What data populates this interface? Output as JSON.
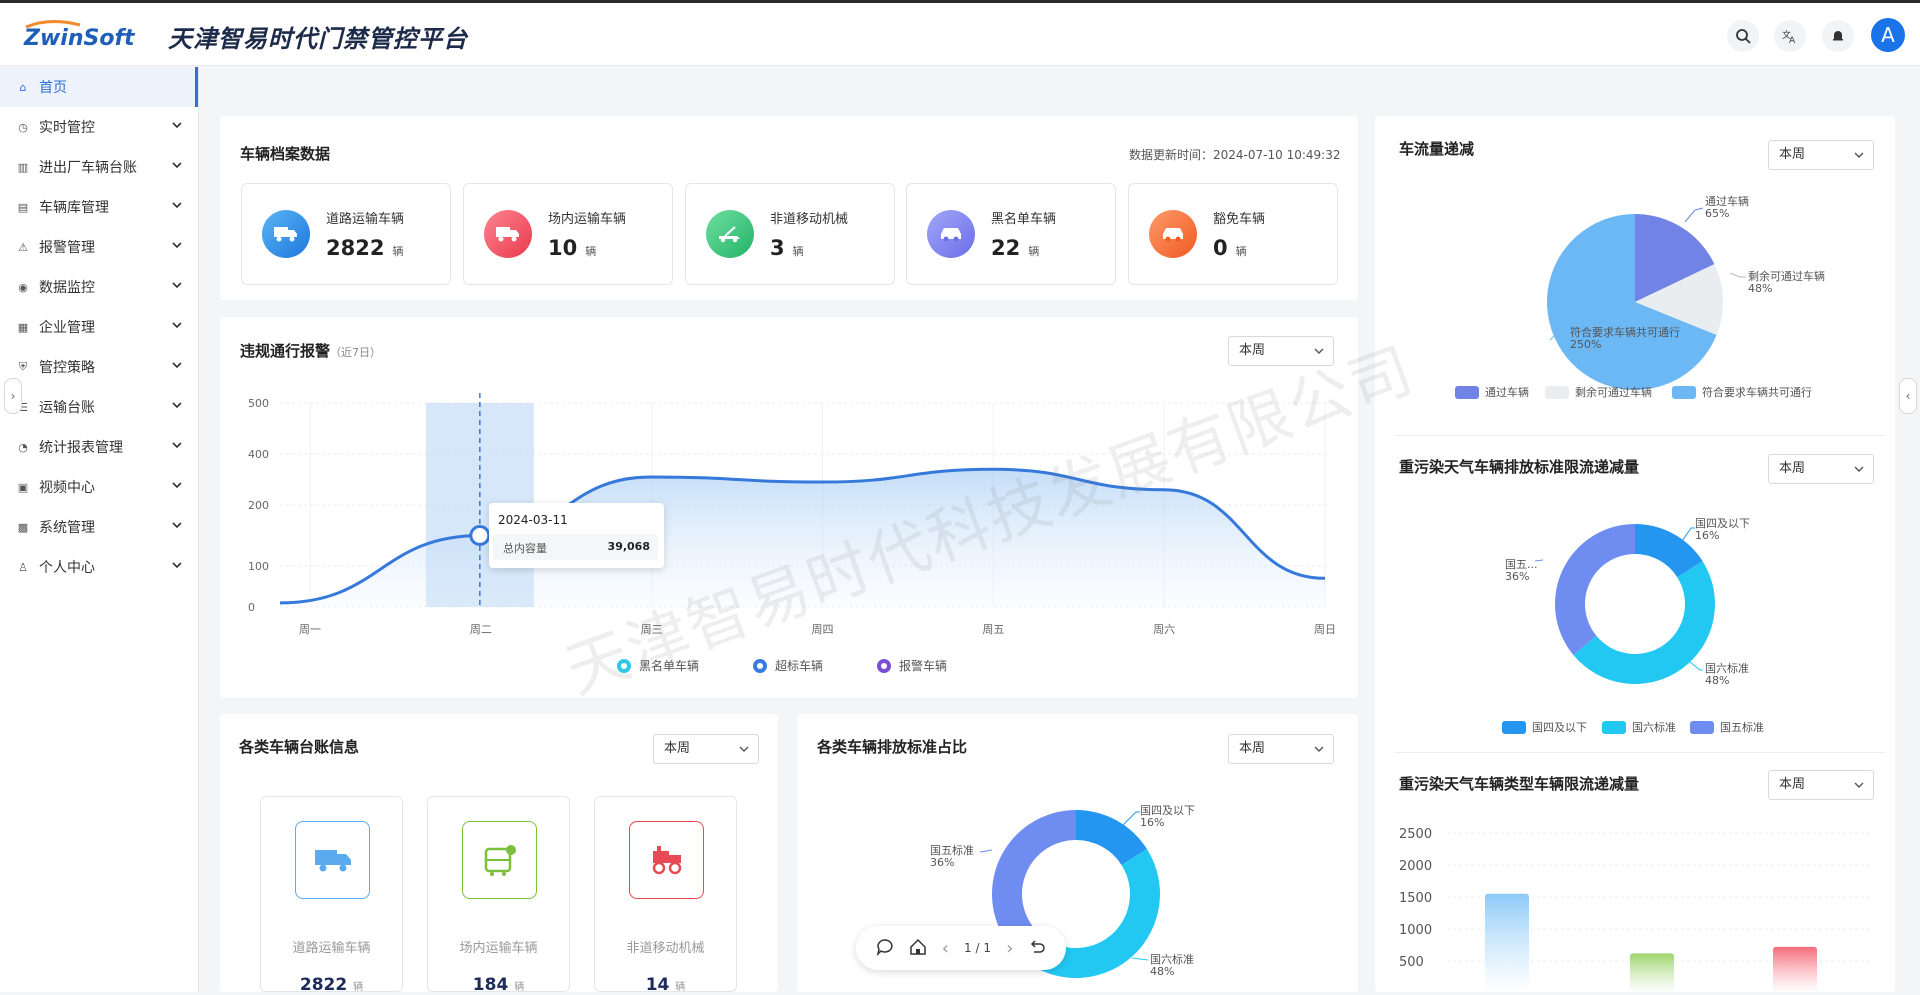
{
  "header": {
    "logo_text": "ZwinSoft",
    "app_title": "天津智易时代门禁管控平台",
    "avatar_letter": "A"
  },
  "sidebar": {
    "items": [
      {
        "label": "首页",
        "icon": "home-icon"
      },
      {
        "label": "实时管控",
        "icon": "clock-icon"
      },
      {
        "label": "进出厂车辆台账",
        "icon": "chart-icon"
      },
      {
        "label": "车辆库管理",
        "icon": "doc-icon"
      },
      {
        "label": "报警管理",
        "icon": "alarm-icon"
      },
      {
        "label": "数据监控",
        "icon": "location-icon"
      },
      {
        "label": "企业管理",
        "icon": "building-icon"
      },
      {
        "label": "管控策略",
        "icon": "shield-icon"
      },
      {
        "label": "运输台账",
        "icon": "ledger-icon"
      },
      {
        "label": "统计报表管理",
        "icon": "gauge-icon"
      },
      {
        "label": "视频中心",
        "icon": "video-icon"
      },
      {
        "label": "系统管理",
        "icon": "grid-icon"
      },
      {
        "label": "个人中心",
        "icon": "user-icon"
      }
    ]
  },
  "archive": {
    "title": "车辆档案数据",
    "update_label": "数据更新时间：",
    "update_time": "2024-07-10 10:49:32",
    "stats": [
      {
        "label": "道路运输车辆",
        "value": "2822",
        "unit": "辆",
        "color": "#2f8fe8"
      },
      {
        "label": "场内运输车辆",
        "value": "10",
        "unit": "辆",
        "color": "#ef4f5f"
      },
      {
        "label": "非道移动机械",
        "value": "3",
        "unit": "辆",
        "color": "#3cc47c"
      },
      {
        "label": "黑名单车辆",
        "value": "22",
        "unit": "辆",
        "color": "#7b7ff0"
      },
      {
        "label": "豁免车辆",
        "value": "0",
        "unit": "辆",
        "color": "#f2703d"
      }
    ]
  },
  "violation": {
    "title": "违规通行报警",
    "subtitle": "（近7日）",
    "select": "本周",
    "tooltip": {
      "date": "2024-03-11",
      "label": "总内容量",
      "value": "39,068"
    },
    "legend": [
      {
        "name": "黑名单车辆",
        "color": "#2fc8e8"
      },
      {
        "name": "超标车辆",
        "color": "#3a7be0"
      },
      {
        "name": "报警车辆",
        "color": "#7a4fd6"
      }
    ]
  },
  "chart_data": [
    {
      "type": "area",
      "categories": [
        "周一",
        "周二",
        "周三",
        "周四",
        "周五",
        "周六",
        "周日"
      ],
      "yticks": [
        "500",
        "400",
        "200",
        "100",
        "0"
      ],
      "series": [
        {
          "values": [
            10,
            150,
            310,
            290,
            340,
            260,
            70
          ]
        }
      ],
      "highlight_category": "周二"
    },
    {
      "type": "pie",
      "title": "车流量递减",
      "labels": [
        "通过车辆",
        "剩余可通过车辆",
        "符合要求车辆共可通行"
      ],
      "values": [
        65,
        48,
        250
      ],
      "label_texts": [
        "65%",
        "48%",
        "250%"
      ],
      "colors": [
        "#7184e6",
        "#eaedf0",
        "#6cb8f5"
      ],
      "legend": "bottom"
    },
    {
      "type": "pie",
      "title": "重污染天气车辆排放标准限流递减量",
      "labels": [
        "国四及以下",
        "国六标准",
        "国五..."
      ],
      "legend_labels": [
        "国四及以下",
        "国六标准",
        "国五标准"
      ],
      "values": [
        16,
        48,
        36
      ],
      "label_texts": [
        "16%",
        "48%",
        "36%"
      ],
      "colors": [
        "#2496ef",
        "#22c8f2",
        "#6f8df0"
      ],
      "legend": "bottom"
    },
    {
      "type": "bar",
      "title": "重污染天气车辆类型车辆限流递减量",
      "yticks": [
        "2500",
        "2000",
        "1500",
        "1000",
        "500"
      ],
      "ylim": [
        0,
        2500
      ],
      "values": [
        1550,
        620,
        720
      ],
      "colors": [
        "#8ccaf8",
        "#9ed26a",
        "#f56b7a"
      ]
    },
    {
      "type": "pie",
      "title": "各类车辆排放标准占比",
      "labels": [
        "国四及以下",
        "国六标准",
        "国五标准"
      ],
      "values": [
        16,
        48,
        36
      ],
      "label_texts": [
        "16%",
        "48%",
        "36%"
      ],
      "colors": [
        "#2496ef",
        "#22c8f2",
        "#6f8df0"
      ]
    }
  ],
  "traffic": {
    "select": "本周"
  },
  "emission_limit": {
    "select": "本周"
  },
  "type_limit": {
    "select": "本周"
  },
  "ledger": {
    "title": "各类车辆台账信息",
    "select": "本周",
    "items": [
      {
        "label": "道路运输车辆",
        "value": "2822",
        "unit": "辆",
        "color": "#2f8fe8"
      },
      {
        "label": "场内运输车辆",
        "value": "184",
        "unit": "辆",
        "color": "#7cbf3a"
      },
      {
        "label": "非道移动机械",
        "value": "14",
        "unit": "辆",
        "color": "#e84a55"
      }
    ]
  },
  "emission_share": {
    "title": "各类车辆排放标准占比",
    "select": "本周"
  },
  "pdf_toolbar": {
    "page": "1 / 1"
  },
  "watermark": "天津智易时代科技发展有限公司"
}
